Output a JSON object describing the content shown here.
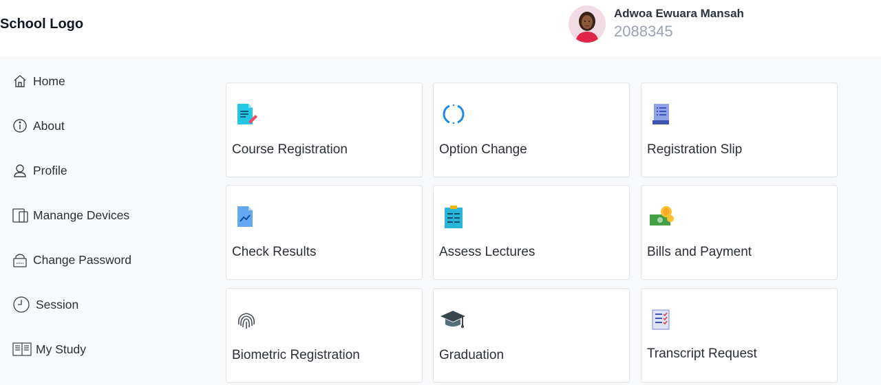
{
  "header": {
    "logo_text": "School Logo",
    "user": {
      "name": "Adwoa Ewuara Mansah",
      "id": "2088345"
    }
  },
  "sidebar": {
    "items": [
      {
        "label": "Home",
        "icon": "home-icon"
      },
      {
        "label": "About",
        "icon": "info-icon"
      },
      {
        "label": "Profile",
        "icon": "user-icon"
      },
      {
        "label": "Manange Devices",
        "icon": "devices-icon"
      },
      {
        "label": "Change Password",
        "icon": "lock-icon"
      },
      {
        "label": "Session",
        "icon": "clock-icon"
      },
      {
        "label": "My Study",
        "icon": "book-icon"
      }
    ]
  },
  "cards": [
    {
      "label": "Course Registration",
      "icon": "document-edit-icon"
    },
    {
      "label": "Option Change",
      "icon": "refresh-icon"
    },
    {
      "label": "Registration Slip",
      "icon": "scroll-icon"
    },
    {
      "label": "Check Results",
      "icon": "chart-document-icon"
    },
    {
      "label": "Assess Lectures",
      "icon": "clipboard-icon"
    },
    {
      "label": "Bills and Payment",
      "icon": "money-icon"
    },
    {
      "label": "Biometric Registration",
      "icon": "fingerprint-icon"
    },
    {
      "label": "Graduation",
      "icon": "graduation-cap-icon"
    },
    {
      "label": "Transcript Request",
      "icon": "checklist-icon"
    }
  ],
  "colors": {
    "header_bg": "#ffffff",
    "page_bg": "#f8f9fb",
    "card_border": "#e1e4e8",
    "muted_text": "#9aa3af"
  }
}
